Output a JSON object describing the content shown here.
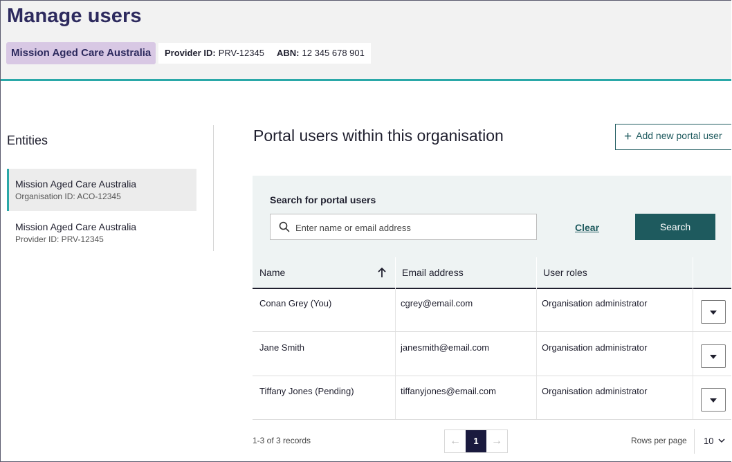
{
  "header": {
    "title": "Manage users",
    "organisation": "Mission Aged Care Australia",
    "provider_label": "Provider ID:",
    "provider_value": "PRV-12345",
    "abn_label": "ABN:",
    "abn_value": "12 345 678 901"
  },
  "sidebar": {
    "title": "Entities",
    "items": [
      {
        "name": "Mission Aged Care Australia",
        "id": "Organisation ID: ACO-12345",
        "active": true
      },
      {
        "name": "Mission Aged Care Australia",
        "id": "Provider ID: PRV-12345",
        "active": false
      }
    ]
  },
  "main": {
    "section_title": "Portal users within this organisation",
    "add_button": "Add new portal user",
    "search": {
      "label": "Search for portal users",
      "placeholder": "Enter name or email address",
      "value": "",
      "clear": "Clear",
      "button": "Search"
    },
    "table": {
      "columns": [
        "Name",
        "Email address",
        "User roles"
      ],
      "sort": {
        "column": "Name",
        "direction": "ascending"
      },
      "rows": [
        {
          "name": "Conan Grey (You)",
          "email": "cgrey@email.com",
          "role": "Organisation administrator"
        },
        {
          "name": "Jane Smith",
          "email": "janesmith@email.com",
          "role": "Organisation administrator"
        },
        {
          "name": "Tiffany Jones (Pending)",
          "email": "tiffanyjones@email.com",
          "role": "Organisation administrator"
        }
      ]
    },
    "pagination": {
      "records": "1-3 of 3 records",
      "current_page": "1",
      "rows_per_page_label": "Rows per page",
      "rows_per_page": "10"
    }
  },
  "colors": {
    "title": "#2d2a5e",
    "org_chip": "#d8c8e4",
    "accent_teal": "#2aa8a8",
    "primary_button": "#1e5a5e",
    "panel_background": "#eef3f3",
    "current_page": "#1a1a3e"
  },
  "icons": [
    "search-icon",
    "plus-icon",
    "sort-up-arrow-icon",
    "caret-down-icon",
    "arrow-left-icon",
    "arrow-right-icon",
    "chevron-down-icon"
  ]
}
